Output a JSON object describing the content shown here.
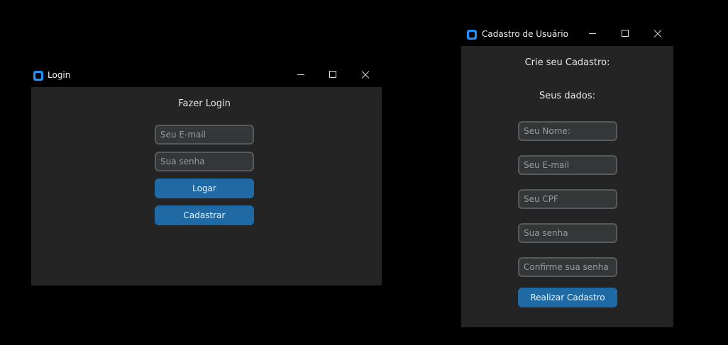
{
  "login_window": {
    "title": "Login",
    "heading": "Fazer Login",
    "email_placeholder": "Seu E-mail",
    "password_placeholder": "Sua senha",
    "login_button": "Logar",
    "register_button": "Cadastrar"
  },
  "register_window": {
    "title": "Cadastro de Usuário",
    "heading": "Crie seu Cadastro:",
    "subheading": "Seus dados:",
    "name_placeholder": "Seu Nome:",
    "email_placeholder": "Seu E-mail",
    "cpf_placeholder": "Seu CPF",
    "password_placeholder": "Sua senha",
    "confirm_password_placeholder": "Confirme sua senha",
    "submit_button": "Realizar Cadastro"
  },
  "theme": {
    "accent": "#1f6aa5",
    "background": "#242424",
    "field_bg": "#343638",
    "icon_color": "#1e90ff"
  }
}
